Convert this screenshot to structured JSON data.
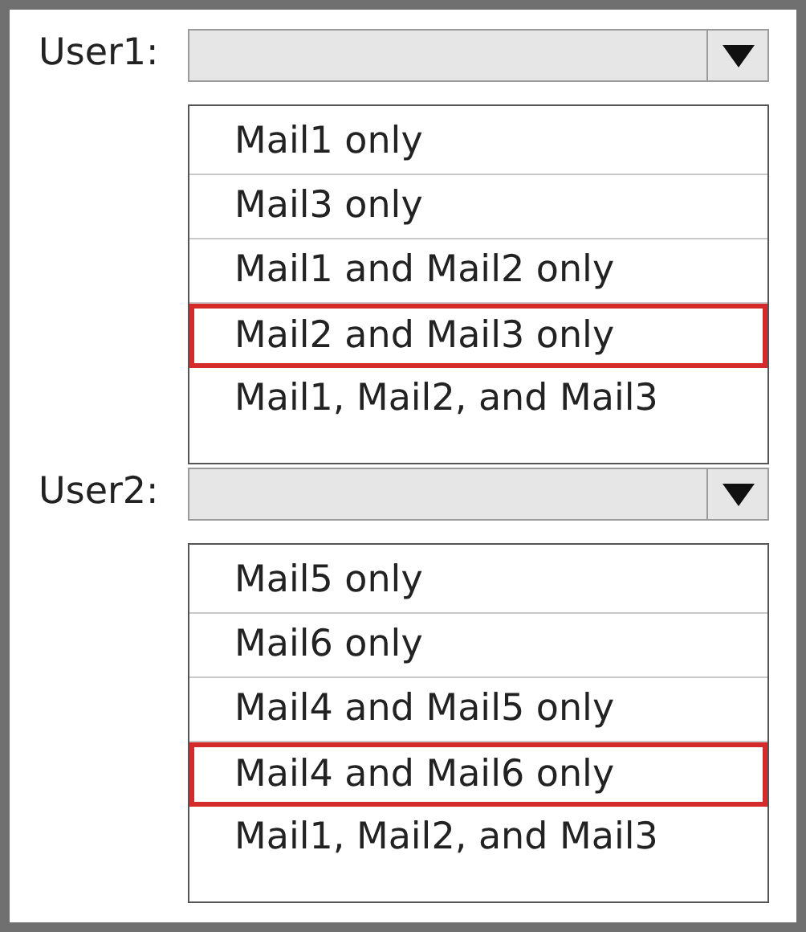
{
  "dropdowns": [
    {
      "label": "User1:",
      "options": [
        {
          "text": "Mail1 only",
          "selected": false
        },
        {
          "text": "Mail3 only",
          "selected": false
        },
        {
          "text": "Mail1 and Mail2 only",
          "selected": false
        },
        {
          "text": "Mail2 and Mail3 only",
          "selected": true
        },
        {
          "text": "Mail1, Mail2, and Mail3",
          "selected": false
        }
      ]
    },
    {
      "label": "User2:",
      "options": [
        {
          "text": "Mail5 only",
          "selected": false
        },
        {
          "text": "Mail6 only",
          "selected": false
        },
        {
          "text": "Mail4 and Mail5 only",
          "selected": false
        },
        {
          "text": "Mail4 and Mail6 only",
          "selected": true
        },
        {
          "text": "Mail1, Mail2, and Mail3",
          "selected": false
        }
      ]
    }
  ]
}
